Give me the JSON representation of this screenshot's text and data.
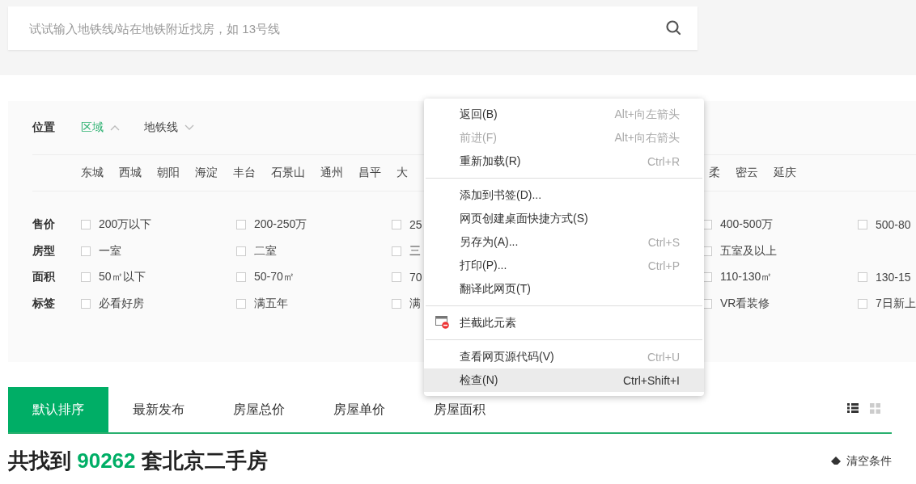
{
  "search": {
    "placeholder": "试试输入地铁线/站在地铁附近找房，如 13号线"
  },
  "location": {
    "label": "位置",
    "tabs": [
      {
        "label": "区域",
        "selected": true
      },
      {
        "label": "地铁线",
        "selected": false
      }
    ],
    "districts": [
      "东城",
      "西城",
      "朝阳",
      "海淀",
      "丰台",
      "石景山",
      "通州",
      "昌平",
      "大"
    ],
    "districts_after_menu": [
      "柔",
      "密云",
      "延庆"
    ]
  },
  "filters": [
    {
      "label": "售价",
      "options": [
        {
          "text": "200万以下",
          "checked": false
        },
        {
          "text": "200-250万",
          "checked": false
        },
        {
          "text": "25",
          "checked": false
        },
        {
          "text": "400-500万",
          "checked": false
        },
        {
          "text": "500-80",
          "checked": false
        }
      ]
    },
    {
      "label": "房型",
      "options": [
        {
          "text": "一室",
          "checked": false
        },
        {
          "text": "二室",
          "checked": false
        },
        {
          "text": "三",
          "checked": false
        },
        {
          "text": "五室及以上",
          "checked": false
        }
      ]
    },
    {
      "label": "面积",
      "options": [
        {
          "text": "50㎡以下",
          "checked": false
        },
        {
          "text": "50-70㎡",
          "checked": false
        },
        {
          "text": "70",
          "checked": false
        },
        {
          "text": "110-130㎡",
          "checked": false
        },
        {
          "text": "130-15",
          "checked": false
        }
      ]
    },
    {
      "label": "标签",
      "options": [
        {
          "text": "必看好房",
          "checked": false
        },
        {
          "text": "满五年",
          "checked": false
        },
        {
          "text": "满",
          "checked": false
        },
        {
          "text": "VR看装修",
          "checked": false
        },
        {
          "text": "7日新上",
          "checked": false
        }
      ]
    }
  ],
  "context_menu": [
    {
      "kind": "item",
      "label": "返回(B)",
      "shortcut": "Alt+向左箭头",
      "disabled": false,
      "highlighted": false
    },
    {
      "kind": "item",
      "label": "前进(F)",
      "shortcut": "Alt+向右箭头",
      "disabled": true,
      "highlighted": false
    },
    {
      "kind": "item",
      "label": "重新加载(R)",
      "shortcut": "Ctrl+R",
      "disabled": false,
      "highlighted": false
    },
    {
      "kind": "separator"
    },
    {
      "kind": "item",
      "label": "添加到书签(D)...",
      "disabled": false,
      "highlighted": false
    },
    {
      "kind": "item",
      "label": "网页创建桌面快捷方式(S)",
      "disabled": false,
      "highlighted": false
    },
    {
      "kind": "item",
      "label": "另存为(A)...",
      "shortcut": "Ctrl+S",
      "disabled": false,
      "highlighted": false
    },
    {
      "kind": "item",
      "label": "打印(P)...",
      "shortcut": "Ctrl+P",
      "disabled": false,
      "highlighted": false
    },
    {
      "kind": "item",
      "label": "翻译此网页(T)",
      "disabled": false,
      "highlighted": false
    },
    {
      "kind": "separator"
    },
    {
      "kind": "icon_item",
      "label": "拦截此元素",
      "disabled": false,
      "highlighted": false
    },
    {
      "kind": "separator"
    },
    {
      "kind": "item",
      "label": "查看网页源代码(V)",
      "shortcut": "Ctrl+U",
      "disabled": false,
      "highlighted": false
    },
    {
      "kind": "item",
      "label": "检查(N)",
      "shortcut": "Ctrl+Shift+I",
      "disabled": false,
      "highlighted": true
    }
  ],
  "sort_tabs": [
    {
      "label": "默认排序",
      "selected": true
    },
    {
      "label": "最新发布",
      "selected": false
    },
    {
      "label": "房屋总价",
      "selected": false
    },
    {
      "label": "房屋单价",
      "selected": false
    },
    {
      "label": "房屋面积",
      "selected": false
    }
  ],
  "view_modes": [
    {
      "kind": "list",
      "selected": true
    },
    {
      "kind": "grid",
      "selected": false
    }
  ],
  "result": {
    "prefix": "共找到",
    "count": "90262",
    "suffix": "套北京二手房"
  },
  "clear_label": "清空条件"
}
